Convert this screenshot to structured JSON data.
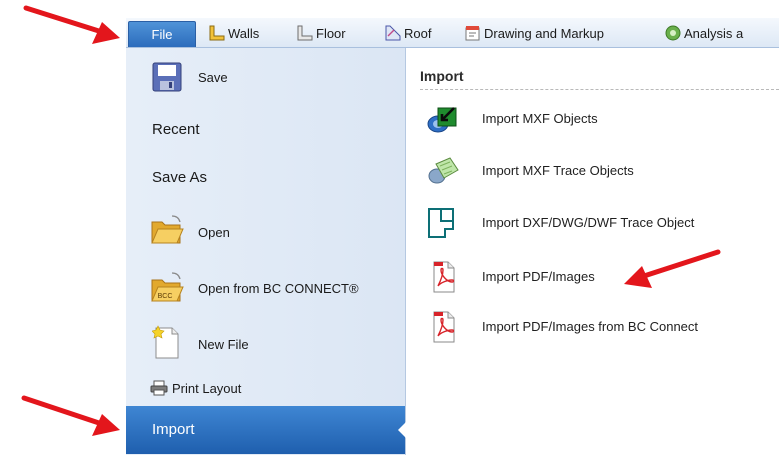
{
  "ribbon": {
    "tabs": [
      {
        "label": "File",
        "icon": "file-tab"
      },
      {
        "label": "Walls",
        "icon": "walls-icon"
      },
      {
        "label": "Floor",
        "icon": "floor-icon"
      },
      {
        "label": "Roof",
        "icon": "roof-icon"
      },
      {
        "label": "Drawing and Markup",
        "icon": "drawing-markup-icon"
      },
      {
        "label": "Analysis a",
        "icon": "analysis-icon"
      }
    ]
  },
  "backstage": {
    "items": [
      {
        "label": "Save",
        "icon": "save-icon"
      },
      {
        "label": "Recent"
      },
      {
        "label": "Save As"
      },
      {
        "label": "Open",
        "icon": "folder-open-icon"
      },
      {
        "label": "Open from BC CONNECT®",
        "icon": "bc-connect-folder-icon",
        "icon_text": "BCC"
      },
      {
        "label": "New File",
        "icon": "new-file-icon"
      },
      {
        "label": "Print Layout",
        "icon": "printer-icon"
      },
      {
        "label": "Import",
        "selected": true
      }
    ]
  },
  "import_panel": {
    "title": "Import",
    "commands": [
      {
        "label": "Import MXF Objects",
        "icon": "import-mxf-objects-icon"
      },
      {
        "label": "Import MXF Trace Objects",
        "icon": "import-mxf-trace-icon"
      },
      {
        "label": "Import DXF/DWG/DWF Trace Object",
        "icon": "import-dxf-trace-icon"
      },
      {
        "label": "Import PDF/Images",
        "icon": "pdf-icon"
      },
      {
        "label": "Import PDF/Images from BC Connect",
        "icon": "pdf-icon"
      }
    ]
  },
  "colors": {
    "accent": "#2c6cbc",
    "annotation": "#e3161c",
    "pane": "#e2ebf6"
  }
}
